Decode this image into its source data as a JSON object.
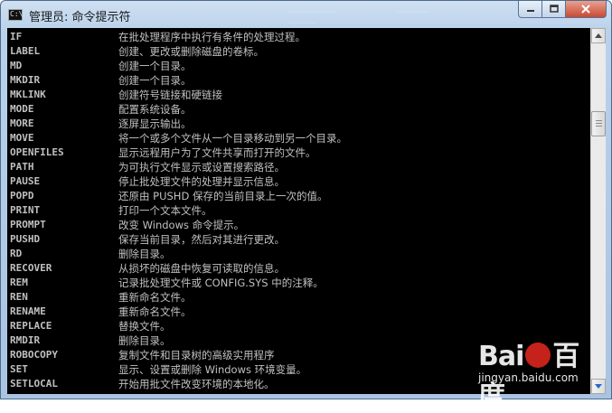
{
  "window": {
    "title": "管理员: 命令提示符",
    "ghost_text": [
      "...............",
      "..........",
      "........."
    ],
    "icon_label": "C:\\"
  },
  "console": {
    "lines": [
      {
        "cmd": "IF",
        "desc": "在批处理程序中执行有条件的处理过程。"
      },
      {
        "cmd": "LABEL",
        "desc": "创建、更改或删除磁盘的卷标。"
      },
      {
        "cmd": "MD",
        "desc": "创建一个目录。"
      },
      {
        "cmd": "MKDIR",
        "desc": "创建一个目录。"
      },
      {
        "cmd": "MKLINK",
        "desc": "创建符号链接和硬链接"
      },
      {
        "cmd": "MODE",
        "desc": "配置系统设备。"
      },
      {
        "cmd": "MORE",
        "desc": "逐屏显示输出。"
      },
      {
        "cmd": "MOVE",
        "desc": "将一个或多个文件从一个目录移动到另一个目录。"
      },
      {
        "cmd": "OPENFILES",
        "desc": "显示远程用户为了文件共享而打开的文件。"
      },
      {
        "cmd": "PATH",
        "desc": "为可执行文件显示或设置搜索路径。"
      },
      {
        "cmd": "PAUSE",
        "desc": "停止批处理文件的处理并显示信息。"
      },
      {
        "cmd": "POPD",
        "desc": "还原由 PUSHD 保存的当前目录上一次的值。"
      },
      {
        "cmd": "PRINT",
        "desc": "打印一个文本文件。"
      },
      {
        "cmd": "PROMPT",
        "desc": "改变 Windows 命令提示。"
      },
      {
        "cmd": "PUSHD",
        "desc": "保存当前目录，然后对其进行更改。"
      },
      {
        "cmd": "RD",
        "desc": "删除目录。"
      },
      {
        "cmd": "RECOVER",
        "desc": "从损坏的磁盘中恢复可读取的信息。"
      },
      {
        "cmd": "REM",
        "desc": "记录批处理文件或 CONFIG.SYS 中的注释。"
      },
      {
        "cmd": "REN",
        "desc": "重新命名文件。"
      },
      {
        "cmd": "RENAME",
        "desc": "重新命名文件。"
      },
      {
        "cmd": "REPLACE",
        "desc": "替换文件。"
      },
      {
        "cmd": "RMDIR",
        "desc": "删除目录。"
      },
      {
        "cmd": "ROBOCOPY",
        "desc": "复制文件和目录树的高级实用程序"
      },
      {
        "cmd": "SET",
        "desc": "显示、设置或删除 Windows 环境变量。"
      },
      {
        "cmd": "SETLOCAL",
        "desc": "开始用批文件改变环境的本地化。"
      }
    ]
  },
  "scrollbar": {
    "position": 0.22
  },
  "watermark": {
    "logo_left": "Bai",
    "logo_right": "百度",
    "subtitle": "jingyan.baidu.com"
  },
  "colors": {
    "console_bg": "#000000",
    "console_text": "#c0c0c0",
    "close_button": "#c74a33"
  }
}
